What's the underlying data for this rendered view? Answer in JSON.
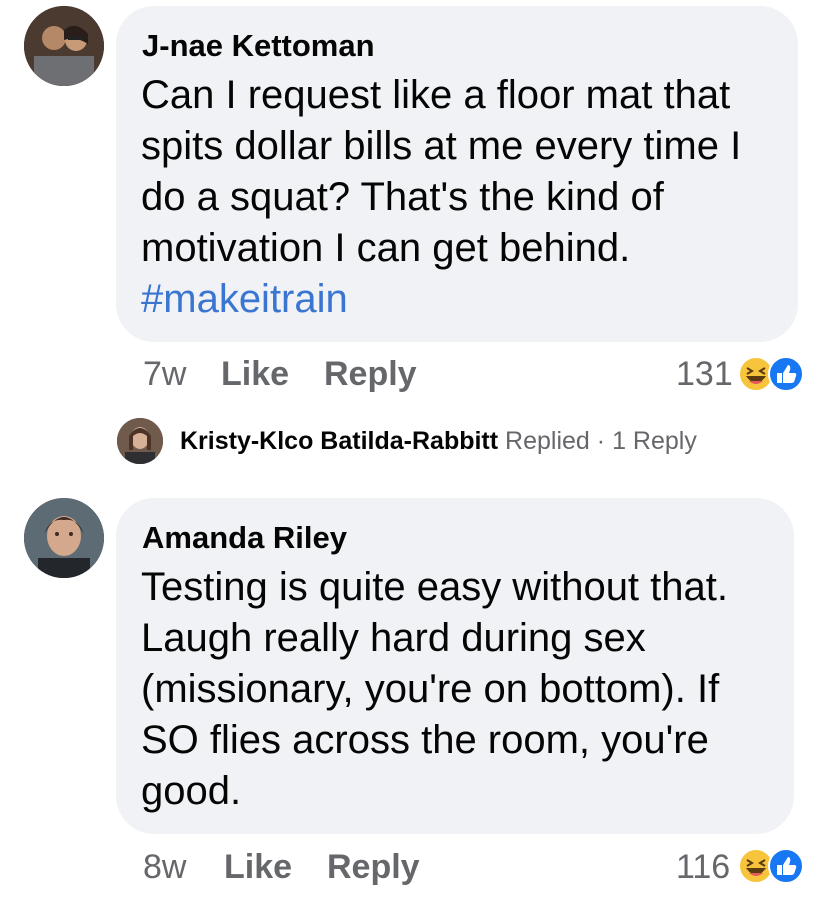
{
  "comments": [
    {
      "author": "J-nae Kettoman",
      "lines": [
        "Can I request like a floor mat that",
        "spits dollar bills at me every time I",
        "do a squat? That's the kind of",
        "motivation I can get behind."
      ],
      "hashtag": "#makeitrain",
      "time": "7w",
      "like_label": "Like",
      "reply_label": "Reply",
      "reaction_count": "131",
      "reactions": [
        "haha-icon",
        "like-icon"
      ]
    },
    {
      "author": "Amanda Riley",
      "lines": [
        "Testing is quite easy without that.",
        "Laugh really hard during sex",
        "(missionary, you're on bottom).  If",
        "SO flies across the room, you're",
        "good."
      ],
      "time": "8w",
      "like_label": "Like",
      "reply_label": "Reply",
      "reaction_count": "116",
      "reactions": [
        "haha-icon",
        "like-icon"
      ]
    }
  ],
  "replies_summary": {
    "name": "Kristy-Klco Batilda-Rabbitt",
    "action": "Replied",
    "separator": "·",
    "count_label": "1 Reply"
  },
  "colors": {
    "bubble": "#f0f2f5",
    "hashtag": "#3a76d1",
    "meta": "#65676b",
    "like_blue": "#1877f2",
    "haha_yellow": "#f7c53b"
  }
}
